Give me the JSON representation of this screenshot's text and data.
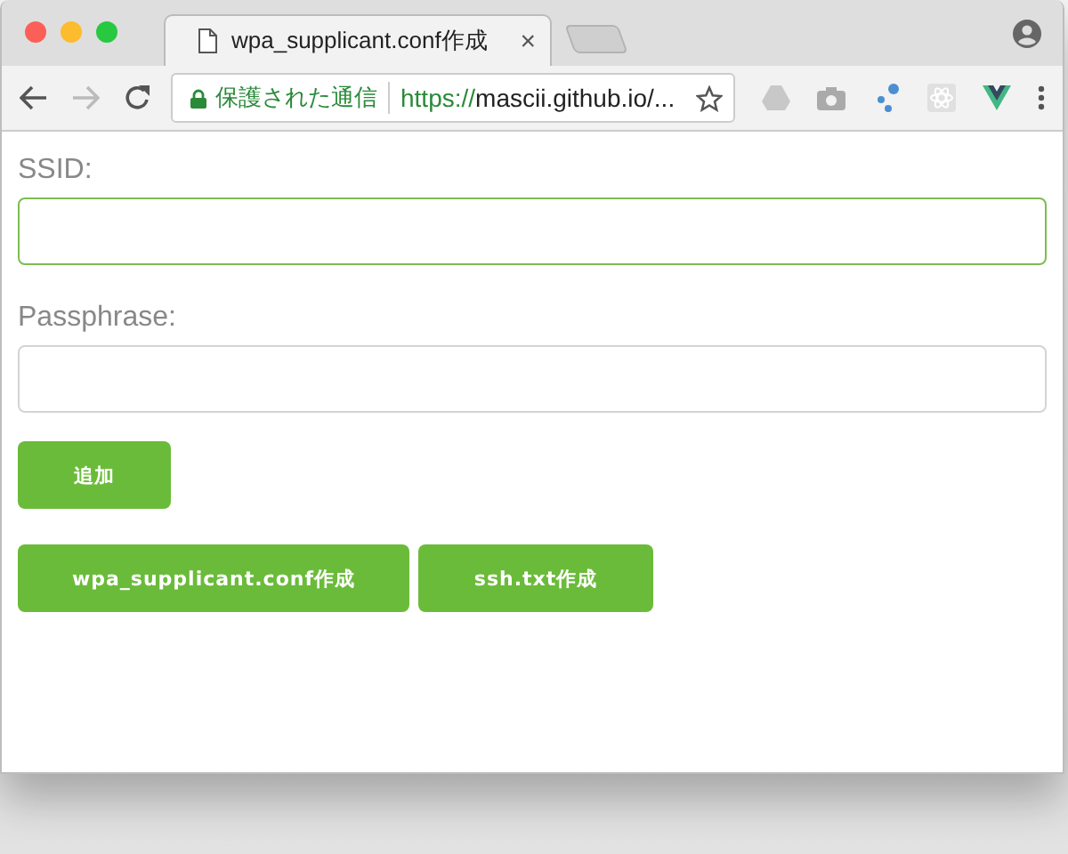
{
  "tab": {
    "title": "wpa_supplicant.conf作成",
    "close": "×"
  },
  "address_bar": {
    "security": "保護された通信",
    "url_scheme": "https://",
    "url_rest": "mascii.github.io/..."
  },
  "fields": [
    {
      "label": "SSID:",
      "focused": true
    },
    {
      "label": "Passphrase:",
      "focused": false
    }
  ],
  "add_button": "追加",
  "buttons": [
    "wpa_supplicant.conf作成",
    "ssh.txt作成"
  ]
}
